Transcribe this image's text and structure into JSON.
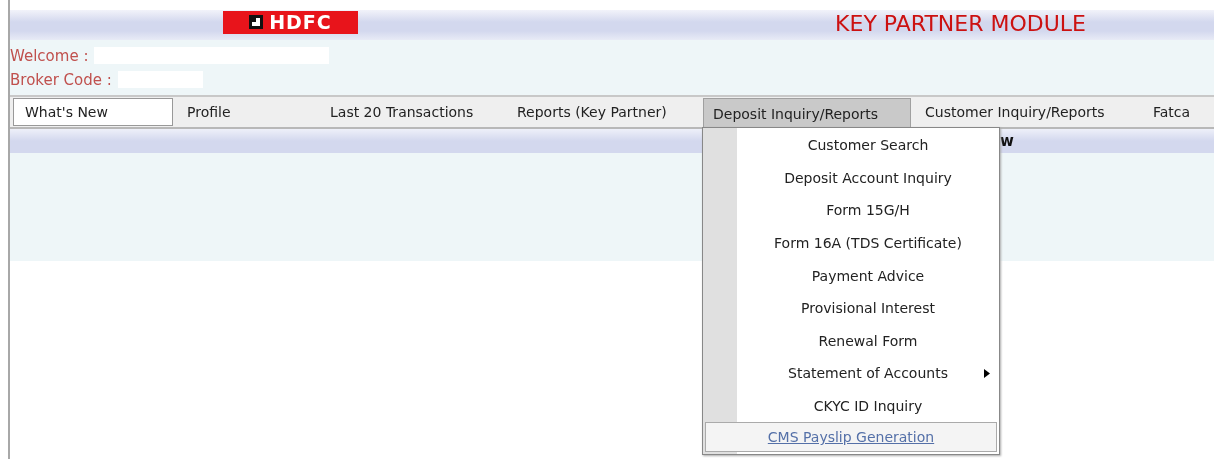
{
  "header": {
    "logo": "HDFC",
    "title": "KEY PARTNER MODULE"
  },
  "user_info": [
    {
      "label": "Welcome :"
    },
    {
      "label": "Broker Code :"
    }
  ],
  "nav_tabs": [
    {
      "label": "What's New",
      "selected": true,
      "expanded": false
    },
    {
      "label": "Profile",
      "selected": false,
      "expanded": false
    },
    {
      "label": "Last 20 Transactions",
      "selected": false,
      "expanded": false
    },
    {
      "label": "Reports (Key Partner)",
      "selected": false,
      "expanded": false
    },
    {
      "label": "Deposit Inquiry/Reports",
      "selected": false,
      "expanded": true
    },
    {
      "label": "Customer Inquiry/Reports",
      "selected": false,
      "expanded": false
    },
    {
      "label": "Fatca",
      "selected": false,
      "expanded": false
    }
  ],
  "section_heading": "w",
  "dropdown_menu": [
    {
      "label": "Customer Search",
      "kind": "item"
    },
    {
      "label": "Deposit Account Inquiry",
      "kind": "item"
    },
    {
      "label": "Form 15G/H",
      "kind": "item"
    },
    {
      "label": "Form 16A (TDS Certificate)",
      "kind": "item"
    },
    {
      "label": "Payment Advice",
      "kind": "item"
    },
    {
      "label": "Provisional Interest",
      "kind": "item"
    },
    {
      "label": "Renewal Form",
      "kind": "item"
    },
    {
      "label": "Statement of Accounts",
      "kind": "submenu"
    },
    {
      "label": "CKYC ID Inquiry",
      "kind": "item"
    },
    {
      "label": "CMS Payslip Generation",
      "kind": "link"
    }
  ]
}
